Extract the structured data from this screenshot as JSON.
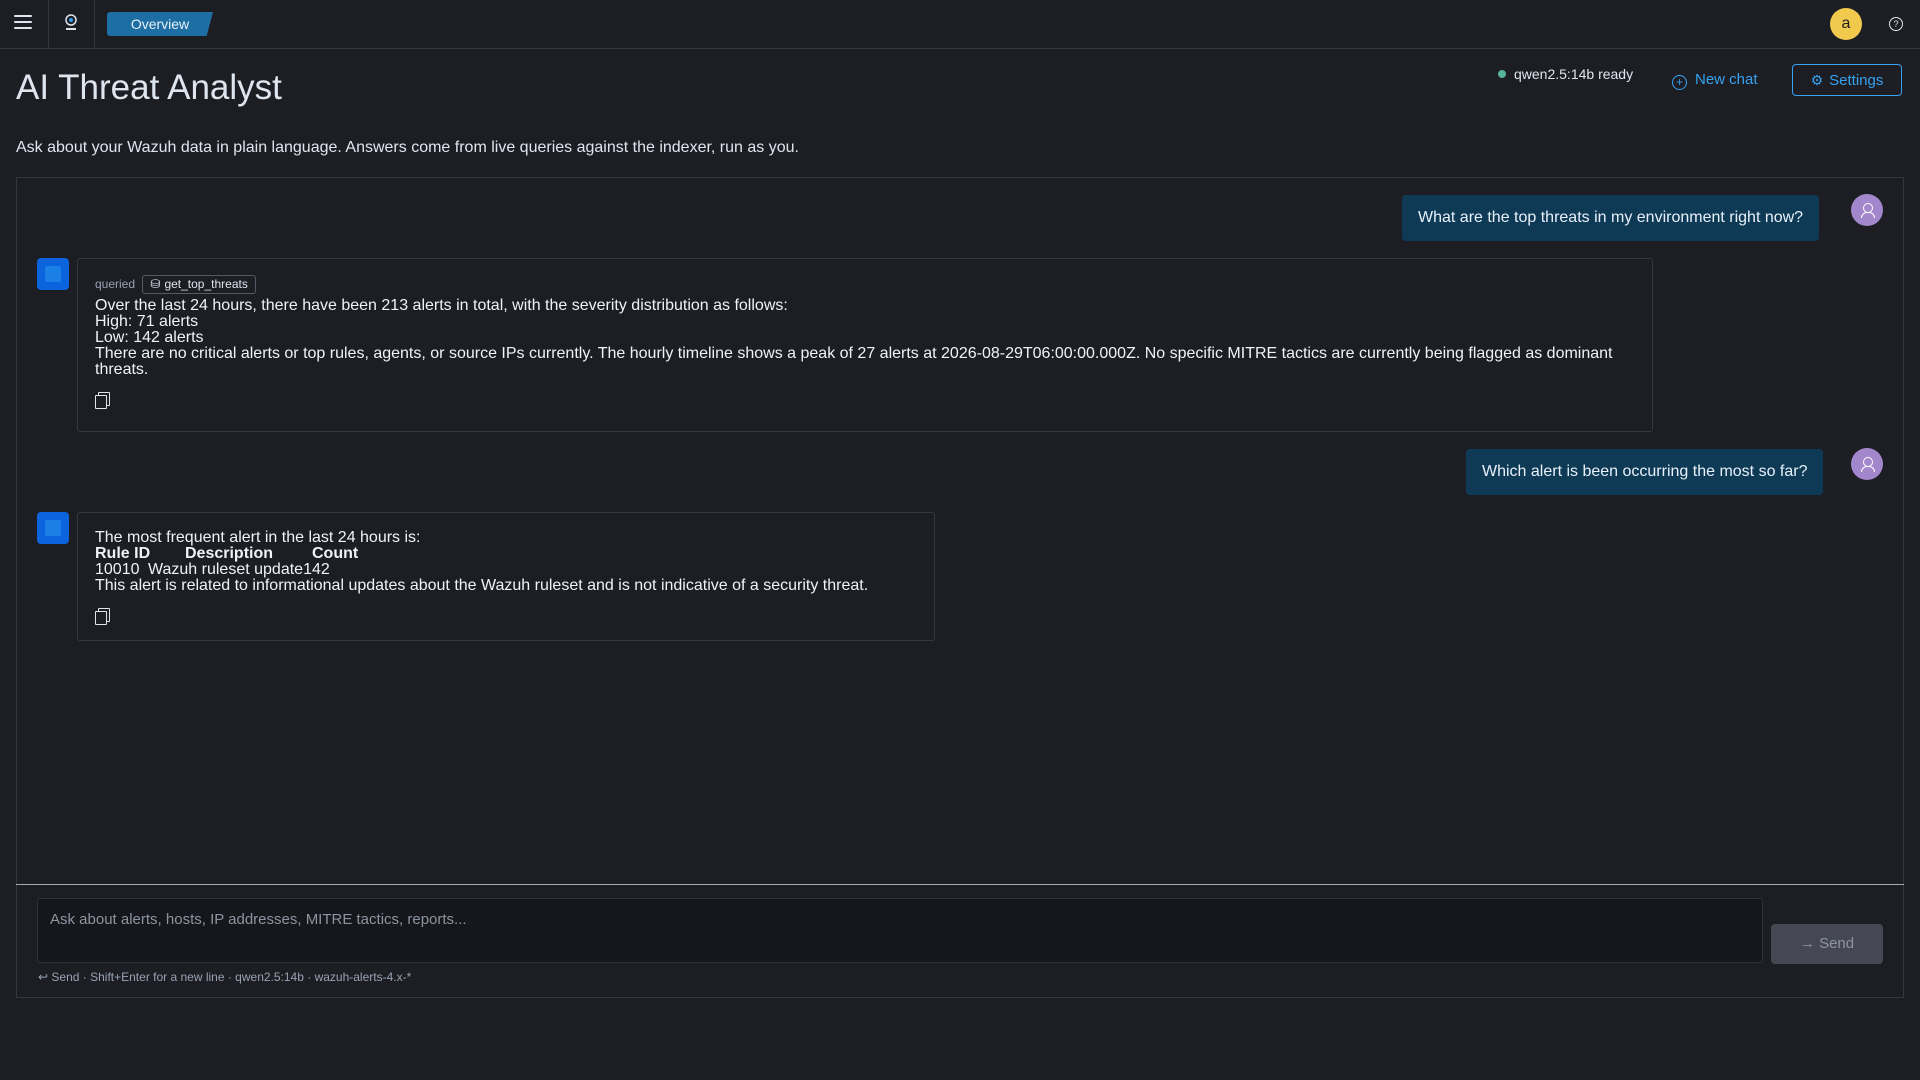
{
  "topbar": {
    "breadcrumb": "Overview",
    "user_initial": "a",
    "help_glyph": "?"
  },
  "header": {
    "title": "AI Threat Analyst",
    "subtitle": "Ask about your Wazuh data in plain language. Answers come from live queries against the indexer, run as you.",
    "status": "qwen2.5:14b ready",
    "new_chat_label": "New chat",
    "settings_label": "Settings"
  },
  "messages": [
    {
      "role": "user",
      "text": "What are the top threats in my environment right now?"
    },
    {
      "role": "assistant",
      "tool_prefix": "queried",
      "tool_name": "get_top_threats",
      "lines": [
        "Over the last 24 hours, there have been 213 alerts in total, with the severity distribution as follows:",
        "High: 71 alerts",
        "Low: 142 alerts",
        "There are no critical alerts or top rules, agents, or source IPs currently. The hourly timeline shows a peak of 27 alerts at 2026-08-29T06:00:00.000Z. No specific MITRE tactics are currently being flagged as dominant threats."
      ]
    },
    {
      "role": "user",
      "text": "Which alert is been occurring the most so far?"
    },
    {
      "role": "assistant",
      "intro": "The most frequent alert in the last 24 hours is:",
      "table": {
        "headers": [
          "Rule ID",
          "Description",
          "Count"
        ],
        "row": [
          "10010",
          "Wazuh ruleset update",
          "142"
        ]
      },
      "outro": "This alert is related to informational updates about the Wazuh ruleset and is not indicative of a security threat."
    }
  ],
  "composer": {
    "placeholder": "Ask about alerts, hosts, IP addresses, MITRE tactics, reports...",
    "send_label": "Send",
    "hint_send": "Send",
    "hint_rest": "Shift+Enter for a new line · qwen2.5:14b · wazuh-alerts-4.x-*"
  },
  "colors": {
    "accent": "#36a2ef",
    "user_bubble": "#0f3a56",
    "status_ready": "#54b399",
    "user_avatar": "#a387cc",
    "assistant_avatar": "#0b64dd"
  },
  "icons": [
    "menu-icon",
    "app-logo-icon",
    "help-icon",
    "plus-circle-icon",
    "gear-icon",
    "database-icon",
    "copy-icon",
    "user-icon",
    "enter-icon",
    "arrow-right-icon"
  ]
}
